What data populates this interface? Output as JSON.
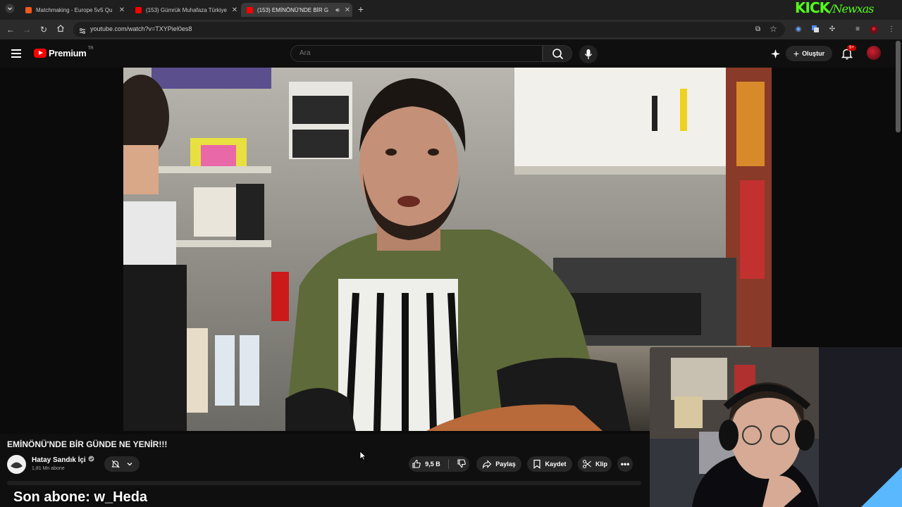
{
  "browser": {
    "tabs": [
      {
        "title": "Matchmaking - Europe 5v5 Qu",
        "favicon_color": "#f05a1a",
        "close": "✕"
      },
      {
        "title": "(153) Gümrük Muhafaza Türkiye",
        "favicon_color": "#ff0000",
        "close": "✕"
      },
      {
        "title": "(153) EMİNÖNÜ'NDE BİR G",
        "favicon_color": "#ff0000",
        "close": "✕",
        "active": true,
        "audio": true
      }
    ],
    "new_tab": "+",
    "url": "youtube.com/watch?v=TXYPiel0es8"
  },
  "kick": {
    "brand": "KICK",
    "user": "/Newxas"
  },
  "youtube": {
    "logo_text": "Premium",
    "country_code": "TR",
    "search_placeholder": "Ara",
    "create_label": "Oluştur",
    "notification_count": "9+"
  },
  "video": {
    "title": "EMİNÖNÜ'NDE BİR GÜNDE NE YENİR!!!",
    "channel": "Hatay Sandık İçi",
    "subscribers": "1,81 Mn abone",
    "likes": "9,5 B",
    "share_label": "Paylaş",
    "save_label": "Kaydet",
    "clip_label": "Klip"
  },
  "overlay": {
    "last_subscriber": "Son abone: w_Heda"
  },
  "colors": {
    "accent": "#ff0000",
    "kick_green": "#53fc18",
    "bg": "#0f0f0f",
    "pill": "#272727"
  }
}
